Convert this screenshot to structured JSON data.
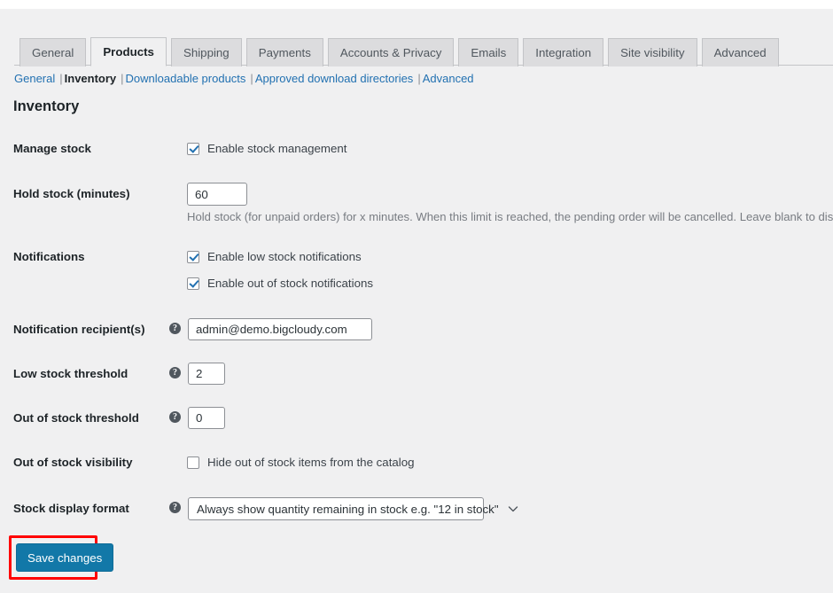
{
  "tabs": [
    {
      "label": "General",
      "active": false
    },
    {
      "label": "Products",
      "active": true
    },
    {
      "label": "Shipping",
      "active": false
    },
    {
      "label": "Payments",
      "active": false
    },
    {
      "label": "Accounts & Privacy",
      "active": false
    },
    {
      "label": "Emails",
      "active": false
    },
    {
      "label": "Integration",
      "active": false
    },
    {
      "label": "Site visibility",
      "active": false
    },
    {
      "label": "Advanced",
      "active": false
    }
  ],
  "subnav": {
    "items": [
      {
        "label": "General",
        "current": false
      },
      {
        "label": "Inventory",
        "current": true
      },
      {
        "label": "Downloadable products",
        "current": false
      },
      {
        "label": "Approved download directories",
        "current": false
      },
      {
        "label": "Advanced",
        "current": false
      }
    ],
    "separator": "|"
  },
  "section": {
    "title": "Inventory"
  },
  "rows": {
    "manage_stock": {
      "label": "Manage stock",
      "checkbox_label": "Enable stock management",
      "checked": true
    },
    "hold_stock": {
      "label": "Hold stock (minutes)",
      "value": "60",
      "description": "Hold stock (for unpaid orders) for x minutes. When this limit is reached, the pending order will be cancelled. Leave blank to disable."
    },
    "notifications": {
      "label": "Notifications",
      "options": [
        {
          "label": "Enable low stock notifications",
          "checked": true
        },
        {
          "label": "Enable out of stock notifications",
          "checked": true
        }
      ]
    },
    "notification_recipients": {
      "label": "Notification recipient(s)",
      "value": "admin@demo.bigcloudy.com",
      "help": "?"
    },
    "low_stock_threshold": {
      "label": "Low stock threshold",
      "value": "2",
      "help": "?"
    },
    "out_of_stock_threshold": {
      "label": "Out of stock threshold",
      "value": "0",
      "help": "?"
    },
    "out_of_stock_visibility": {
      "label": "Out of stock visibility",
      "checkbox_label": "Hide out of stock items from the catalog",
      "checked": false
    },
    "stock_display_format": {
      "label": "Stock display format",
      "help": "?",
      "selected": "Always show quantity remaining in stock e.g. \"12 in stock\"",
      "icon": "chevron-down-icon"
    }
  },
  "footer": {
    "save_label": "Save changes"
  },
  "colors": {
    "accent": "#2271b1",
    "button": "#1278a8",
    "highlight": "#ff0000",
    "background": "#f0f0f1",
    "tab_inactive": "#dcdcde",
    "border": "#c3c4c7",
    "text": "#1d2327",
    "muted": "#787c82"
  }
}
